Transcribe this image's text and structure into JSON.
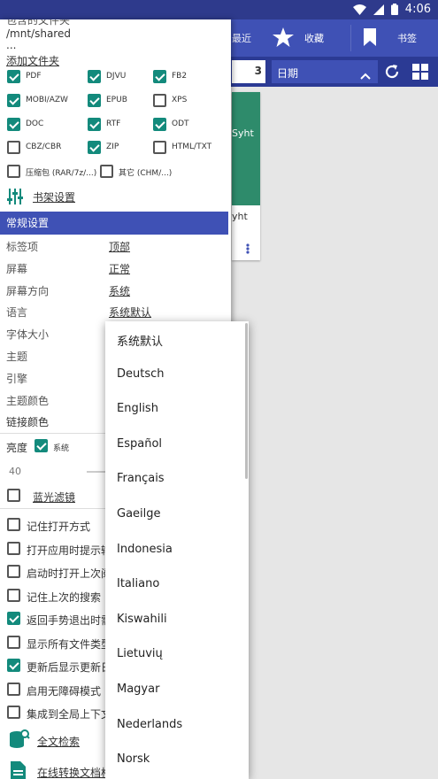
{
  "status": {
    "time": "4:06"
  },
  "background": {
    "tabs": {
      "recent": "最近",
      "favorites": "收藏",
      "bookmarks": "书签"
    },
    "count": "3",
    "sort_label": "日期",
    "card_title": "Syht",
    "card_sub": "yht"
  },
  "folders": {
    "header": "包含的文件夹",
    "path": "/mnt/shared",
    "ellipsis": "...",
    "add_folder": "添加文件夹"
  },
  "formats": [
    {
      "label": "PDF",
      "checked": true
    },
    {
      "label": "DJVU",
      "checked": true
    },
    {
      "label": "FB2",
      "checked": true
    },
    {
      "label": "MOBI/AZW",
      "checked": true
    },
    {
      "label": "EPUB",
      "checked": true
    },
    {
      "label": "XPS",
      "checked": false
    },
    {
      "label": "DOC",
      "checked": true
    },
    {
      "label": "RTF",
      "checked": true
    },
    {
      "label": "ODT",
      "checked": true
    },
    {
      "label": "CBZ/CBR",
      "checked": false
    },
    {
      "label": "ZIP",
      "checked": true
    },
    {
      "label": "HTML/TXT",
      "checked": false
    },
    {
      "label": "压缩包 (RAR/7z/...)",
      "checked": false
    },
    {
      "label": "其它 (CHM/...)",
      "checked": false
    }
  ],
  "shelf_settings": "书架设置",
  "general": {
    "title": "常规设置",
    "rows": [
      {
        "label": "标签项",
        "value": "顶部"
      },
      {
        "label": "屏幕",
        "value": "正常"
      },
      {
        "label": "屏幕方向",
        "value": "系统"
      },
      {
        "label": "语言",
        "value": "系统默认"
      },
      {
        "label": "字体大小",
        "value": ""
      },
      {
        "label": "主题",
        "value": ""
      },
      {
        "label": "引擎",
        "value": ""
      },
      {
        "label": "主题颜色",
        "value": ""
      }
    ],
    "link_color": "链接颜色",
    "brightness_label": "亮度",
    "brightness_system": "系统",
    "brightness_value": "40",
    "blue_filter": "蓝光滤镜"
  },
  "options": [
    {
      "label": "记住打开方式",
      "checked": false
    },
    {
      "label": "打开应用时提示输",
      "checked": false
    },
    {
      "label": "启动时打开上次阅",
      "checked": false
    },
    {
      "label": "记住上次的搜索",
      "checked": false
    },
    {
      "label": "返回手势退出时需",
      "checked": true
    },
    {
      "label": "显示所有文件类型",
      "checked": false
    },
    {
      "label": "更新后显示更新日",
      "checked": true
    },
    {
      "label": "启用无障碍模式",
      "checked": false
    },
    {
      "label": "集成到全局上下文",
      "checked": false
    }
  ],
  "fulltext_search": "全文检索",
  "online_convert": "在线转换文档格",
  "languages": [
    "系统默认",
    "Deutsch",
    "English",
    "Español",
    "Français",
    "Gaeilge",
    "Indonesia",
    "Italiano",
    "Kiswahili",
    "Lietuvių",
    "Magyar",
    "Nederlands",
    "Norsk"
  ]
}
